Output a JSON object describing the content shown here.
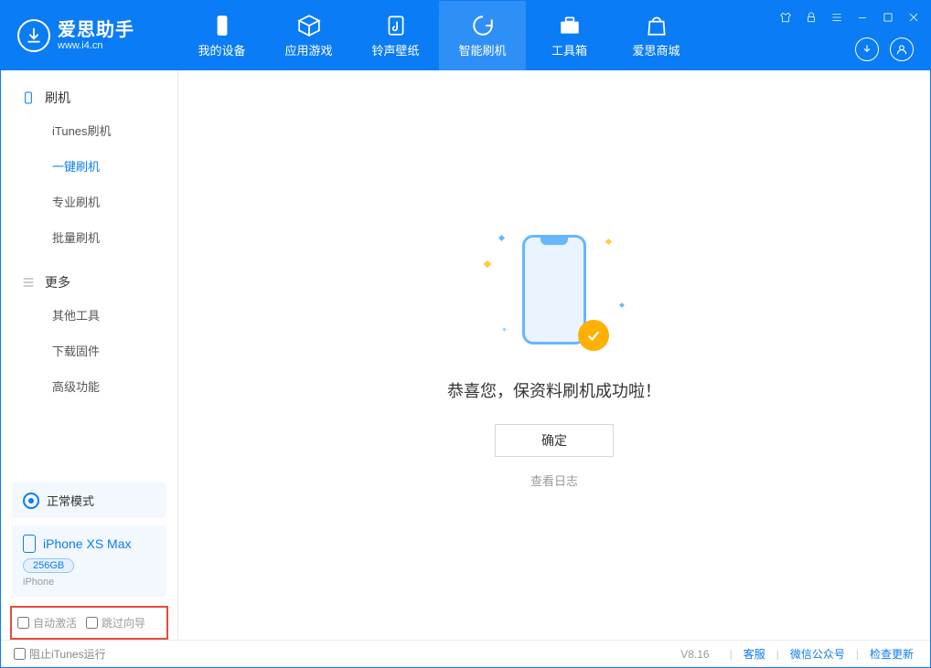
{
  "app": {
    "title": "爱思助手",
    "subtitle": "www.i4.cn"
  },
  "header_tabs": [
    {
      "label": "我的设备"
    },
    {
      "label": "应用游戏"
    },
    {
      "label": "铃声壁纸"
    },
    {
      "label": "智能刷机"
    },
    {
      "label": "工具箱"
    },
    {
      "label": "爱思商城"
    }
  ],
  "sidebar": {
    "group1": {
      "title": "刷机",
      "items": [
        {
          "label": "iTunes刷机"
        },
        {
          "label": "一键刷机"
        },
        {
          "label": "专业刷机"
        },
        {
          "label": "批量刷机"
        }
      ]
    },
    "group2": {
      "title": "更多",
      "items": [
        {
          "label": "其他工具"
        },
        {
          "label": "下载固件"
        },
        {
          "label": "高级功能"
        }
      ]
    },
    "mode": "正常模式",
    "device": {
      "name": "iPhone XS Max",
      "storage": "256GB",
      "type": "iPhone"
    },
    "options": {
      "auto_activate": "自动激活",
      "skip_guide": "跳过向导"
    }
  },
  "main": {
    "message": "恭喜您，保资料刷机成功啦！",
    "ok": "确定",
    "view_log": "查看日志"
  },
  "footer": {
    "block_itunes": "阻止iTunes运行",
    "version": "V8.16",
    "links": {
      "service": "客服",
      "wechat": "微信公众号",
      "update": "检查更新"
    }
  }
}
